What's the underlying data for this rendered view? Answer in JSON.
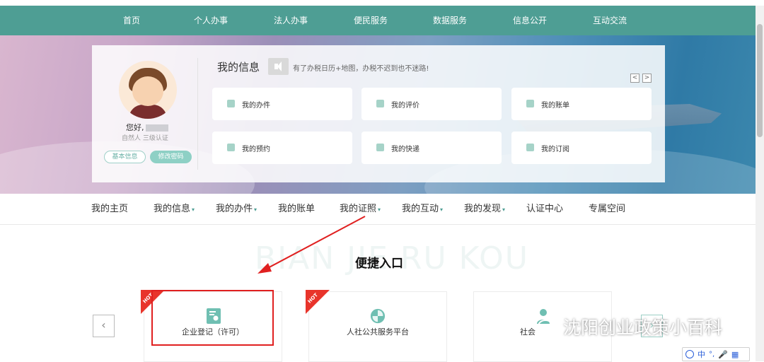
{
  "top_nav": [
    "首页",
    "个人办事",
    "法人办事",
    "便民服务",
    "数据服务",
    "信息公开",
    "互动交流"
  ],
  "user": {
    "greeting": "您好,",
    "auth_level": "自然人 三级认证",
    "basic_info_btn": "基本信息",
    "change_pwd_btn": "修改密码"
  },
  "info": {
    "title": "我的信息",
    "tip": "有了办税日历+地图，办税不迟到也不迷路!",
    "prev": "<",
    "next": ">"
  },
  "cards": [
    "我的办件",
    "我的评价",
    "我的账单",
    "我的预约",
    "我的快递",
    "我的订阅"
  ],
  "sub_nav": [
    {
      "label": "我的主页",
      "caret": ""
    },
    {
      "label": "我的信息",
      "caret": "▾"
    },
    {
      "label": "我的办件",
      "caret": "▾"
    },
    {
      "label": "我的账单",
      "caret": ""
    },
    {
      "label": "我的证照",
      "caret": "▾"
    },
    {
      "label": "我的互动",
      "caret": "▾"
    },
    {
      "label": "我的发现",
      "caret": "▾"
    },
    {
      "label": "认证中心",
      "caret": ""
    },
    {
      "label": "专属空间",
      "caret": ""
    }
  ],
  "quick": {
    "bg_text": "BIAN JIE RU KOU",
    "title": "便捷入口",
    "prev": "‹",
    "next": "›",
    "items": [
      "企业登记（许可）",
      "人社公共服务平台",
      "社会"
    ],
    "hot": "HOT"
  },
  "watermark": "沈阳创业政策小百科",
  "ime": {
    "lang": "中"
  }
}
